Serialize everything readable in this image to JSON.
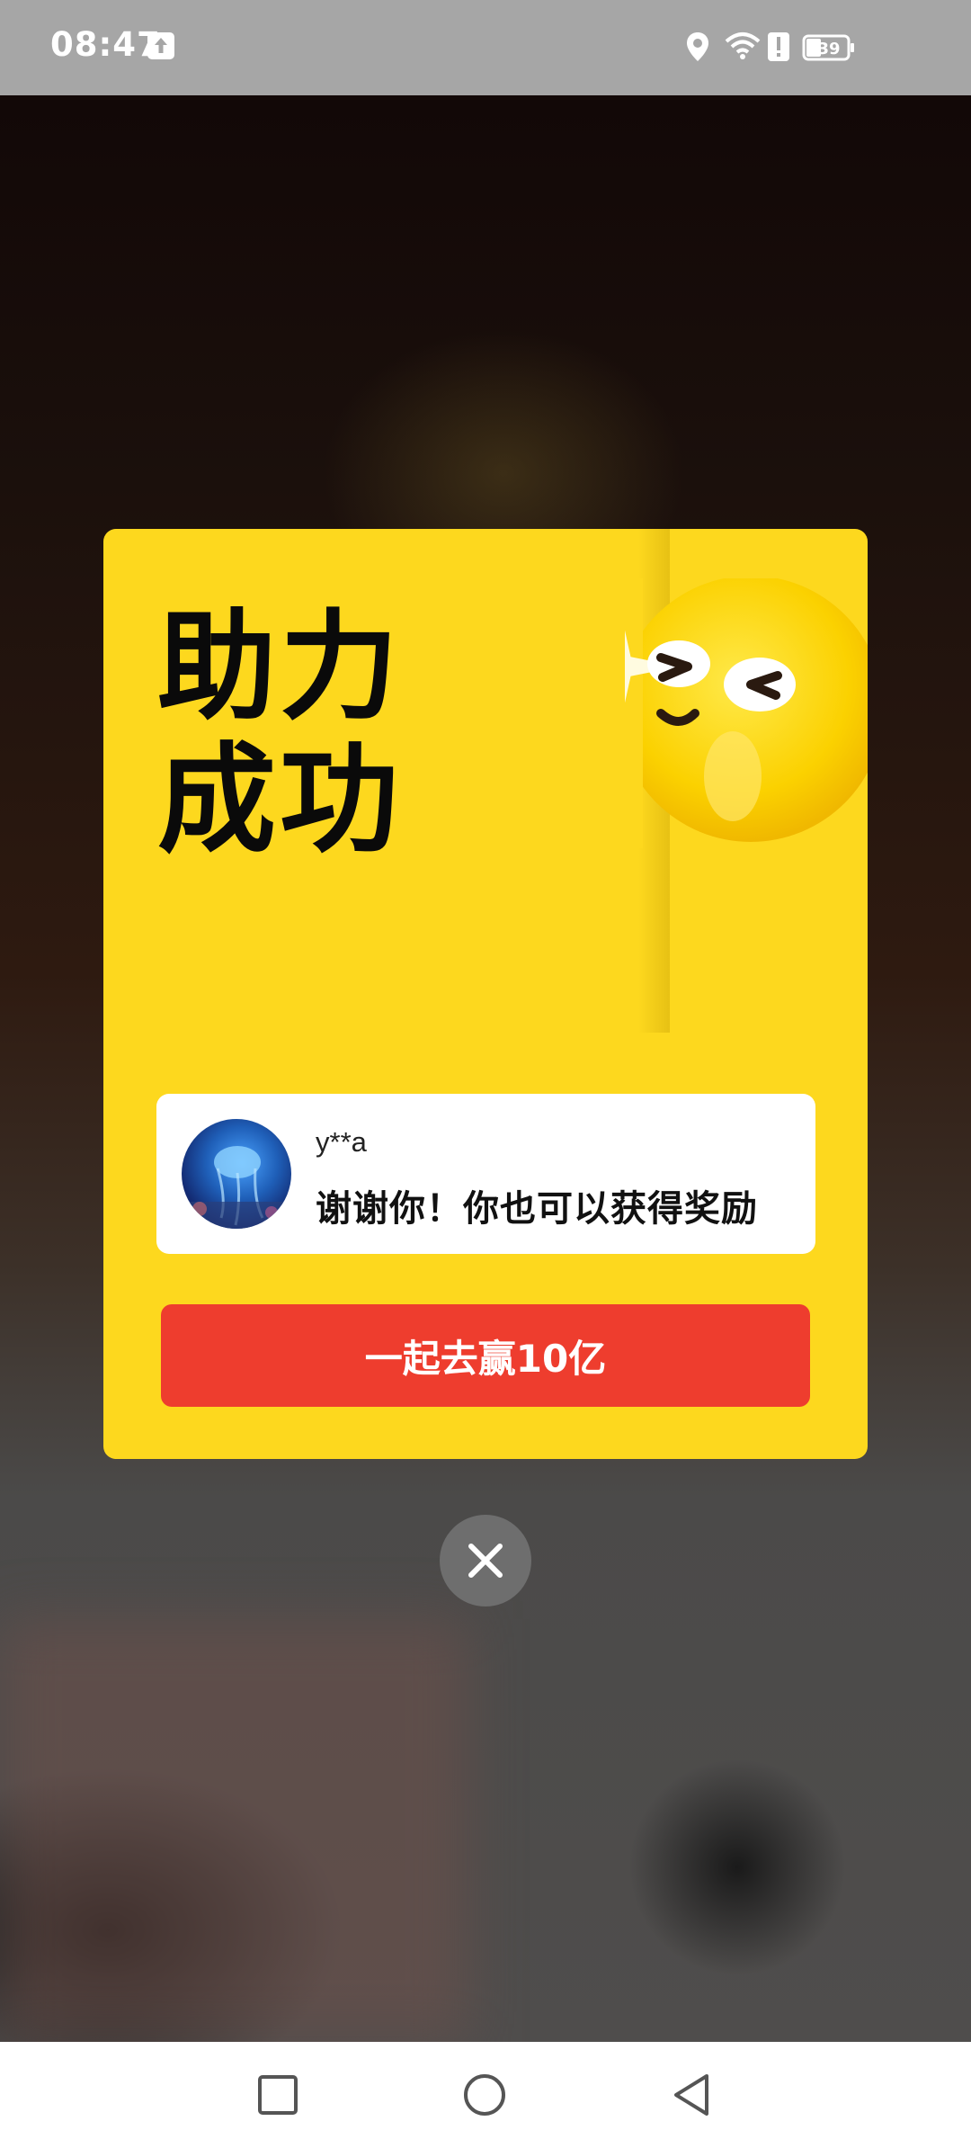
{
  "status_bar": {
    "time": "08:47",
    "battery": "39",
    "icons": [
      "upload-icon",
      "location-icon",
      "wifi-icon",
      "alert-icon",
      "battery-icon"
    ]
  },
  "modal": {
    "title_line1": "助力",
    "title_line2": "成功",
    "user": {
      "name": "y**a",
      "message": "谢谢你！你也可以获得奖励"
    },
    "cta_label": "一起去赢10亿"
  },
  "nav": {
    "icons": [
      "recents-square-icon",
      "home-circle-icon",
      "back-triangle-icon"
    ]
  },
  "colors": {
    "card": "#fdd81e",
    "cta": "#ee3d2e",
    "title": "#0a0a0a"
  }
}
